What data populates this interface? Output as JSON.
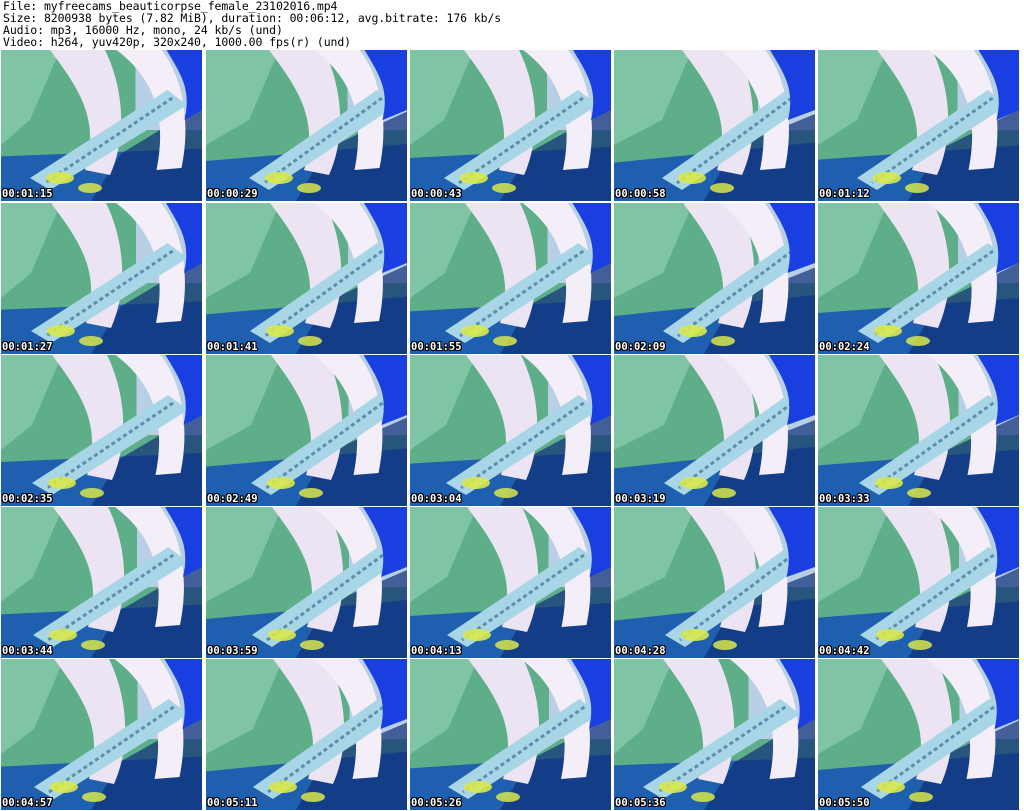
{
  "header": {
    "file_line": "File: myfreecams_beauticorpse_female_23102016.mp4",
    "size_line": "Size: 8200938 bytes (7.82 MiB), duration: 00:06:12, avg.bitrate: 176 kb/s",
    "audio_line": "Audio: mp3, 16000 Hz, mono, 24 kb/s (und)",
    "video_line": "Video: h264, yuv420p, 320x240, 1000.00 fps(r) (und)"
  },
  "thumbnails": [
    {
      "timestamp": "00:01:15"
    },
    {
      "timestamp": "00:00:29"
    },
    {
      "timestamp": "00:00:43"
    },
    {
      "timestamp": "00:00:58"
    },
    {
      "timestamp": "00:01:12"
    },
    {
      "timestamp": "00:01:27"
    },
    {
      "timestamp": "00:01:41"
    },
    {
      "timestamp": "00:01:55"
    },
    {
      "timestamp": "00:02:09"
    },
    {
      "timestamp": "00:02:24"
    },
    {
      "timestamp": "00:02:35"
    },
    {
      "timestamp": "00:02:49"
    },
    {
      "timestamp": "00:03:04"
    },
    {
      "timestamp": "00:03:19"
    },
    {
      "timestamp": "00:03:33"
    },
    {
      "timestamp": "00:03:44"
    },
    {
      "timestamp": "00:03:59"
    },
    {
      "timestamp": "00:04:13"
    },
    {
      "timestamp": "00:04:28"
    },
    {
      "timestamp": "00:04:42"
    },
    {
      "timestamp": "00:04:57"
    },
    {
      "timestamp": "00:05:11"
    },
    {
      "timestamp": "00:05:26"
    },
    {
      "timestamp": "00:05:36"
    },
    {
      "timestamp": "00:05:50"
    }
  ],
  "colors": {
    "background": "#ffffff",
    "header_text": "#000000",
    "timestamp_text": "#ffffff",
    "timestamp_outline": "#000000",
    "scene_green": "#5fae8a",
    "scene_blue": "#1f5fb0",
    "scene_skin": "#ece4f2",
    "scene_hair": "#1a3fe0",
    "scene_yellow": "#d8e84a"
  }
}
